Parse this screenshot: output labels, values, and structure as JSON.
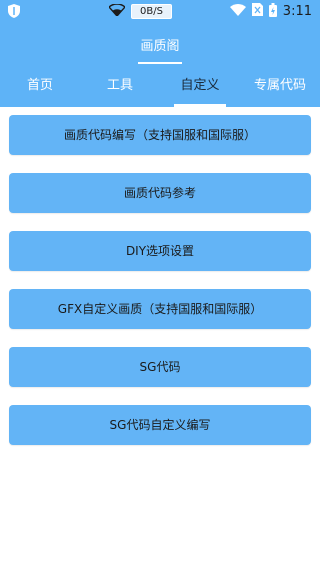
{
  "status_bar": {
    "speed": "0B/S",
    "time": "3:11",
    "icons": [
      "shield-icon",
      "wifi-icon",
      "signal-icon",
      "no-sim-icon",
      "battery-icon"
    ]
  },
  "header": {
    "title": "画质阁"
  },
  "tabs": [
    {
      "label": "首页",
      "active": false
    },
    {
      "label": "工具",
      "active": false
    },
    {
      "label": "自定义",
      "active": true
    },
    {
      "label": "专属代码",
      "active": false
    }
  ],
  "buttons": [
    {
      "label": "画质代码编写（支持国服和国际服）"
    },
    {
      "label": "画质代码参考"
    },
    {
      "label": "DIY选项设置"
    },
    {
      "label": "GFX自定义画质（支持国服和国际服）"
    },
    {
      "label": "SG代码"
    },
    {
      "label": "SG代码自定义编写"
    }
  ],
  "colors": {
    "primary": "#5eb3f7",
    "button": "#63b4f6",
    "background": "#ffffff"
  }
}
